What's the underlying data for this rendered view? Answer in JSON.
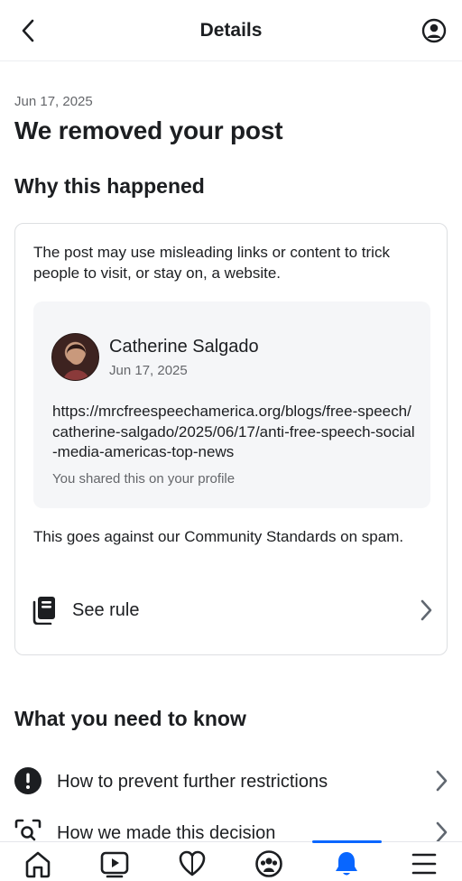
{
  "header": {
    "title": "Details",
    "back_icon": "chevron-left-icon",
    "profile_icon": "user-circle-icon"
  },
  "notice": {
    "date": "Jun 17, 2025",
    "title": "We removed your post"
  },
  "why": {
    "heading": "Why this happened",
    "reason": "The post may use misleading links or content to trick people to visit, or stay on, a website.",
    "post": {
      "author": "Catherine Salgado",
      "date": "Jun 17, 2025",
      "url": "https://mrcfreespeechamerica.org/blogs/free-speech/catherine-salgado/2025/06/17/anti-free-speech-social-media-americas-top-news",
      "shared_note": "You shared this on your profile"
    },
    "standards": "This goes against our Community Standards on spam.",
    "see_rule_label": "See rule",
    "see_rule_icon": "rulebook-icon"
  },
  "know": {
    "heading": "What you need to know",
    "items": [
      {
        "label": "How to prevent further restrictions",
        "icon": "exclamation-circle-icon"
      },
      {
        "label": "How we made this decision",
        "icon": "magnify-scan-icon"
      }
    ]
  },
  "tabbar": {
    "tabs": [
      "home-icon",
      "video-icon",
      "dating-heart-icon",
      "groups-icon",
      "notifications-bell-icon",
      "menu-icon"
    ],
    "active": "notifications-bell-icon",
    "accent_color": "#0866ff"
  }
}
